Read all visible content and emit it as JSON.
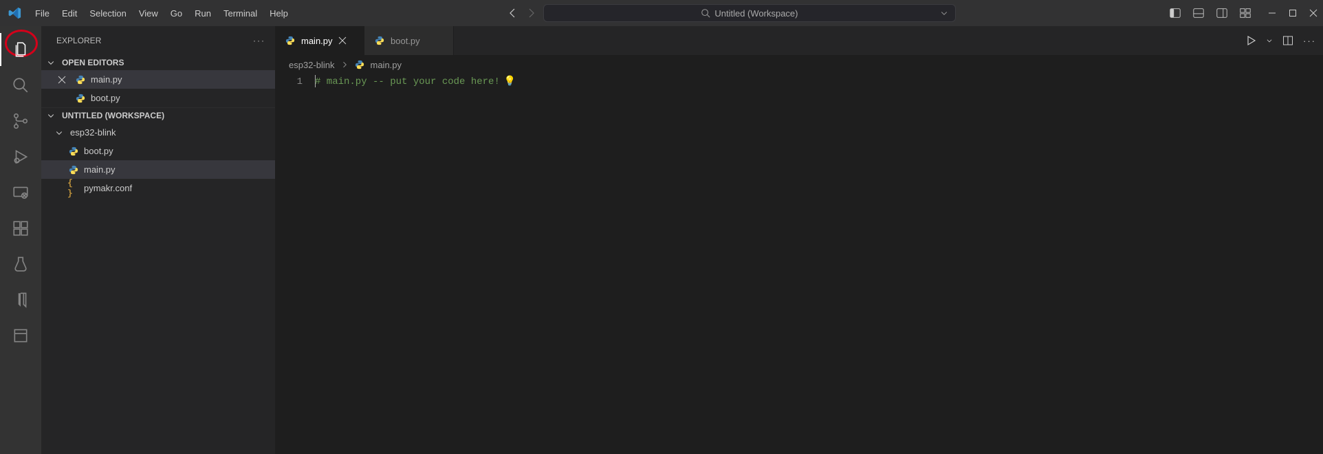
{
  "menu": {
    "items": [
      "File",
      "Edit",
      "Selection",
      "View",
      "Go",
      "Run",
      "Terminal",
      "Help"
    ]
  },
  "search_placeholder": "Untitled (Workspace)",
  "sidebar": {
    "title": "EXPLORER",
    "open_editors_label": "OPEN EDITORS",
    "open_editors": [
      {
        "name": "main.py",
        "active": true,
        "show_close": true,
        "type": "python"
      },
      {
        "name": "boot.py",
        "active": false,
        "show_close": false,
        "type": "python"
      }
    ],
    "workspace_label": "UNTITLED (WORKSPACE)",
    "folder": {
      "name": "esp32-blink",
      "files": [
        {
          "name": "boot.py",
          "active": false,
          "type": "python"
        },
        {
          "name": "main.py",
          "active": true,
          "type": "python"
        },
        {
          "name": "pymakr.conf",
          "active": false,
          "type": "json"
        }
      ]
    }
  },
  "tabs": [
    {
      "name": "main.py",
      "active": true
    },
    {
      "name": "boot.py",
      "active": false
    }
  ],
  "breadcrumbs": {
    "folder": "esp32-blink",
    "file": "main.py"
  },
  "editor": {
    "line_number": "1",
    "comment": "# main.py -- put your code here!"
  },
  "activity": {
    "items": [
      "explorer",
      "search",
      "source-control",
      "run-debug",
      "remote",
      "extensions",
      "testing",
      "bookmark",
      "library"
    ]
  }
}
